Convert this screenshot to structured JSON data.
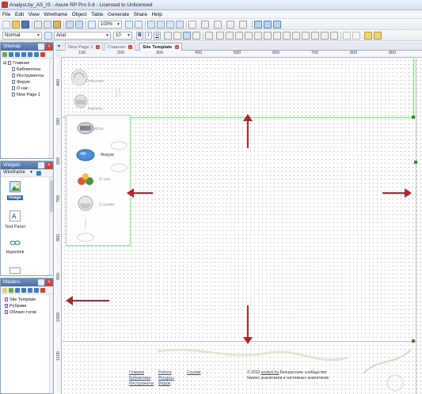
{
  "window": {
    "title": "Analyst.by_AS_IS - Axure RP Pro 5.6 : Licensed to Unlicensed"
  },
  "menu": {
    "items": [
      "File",
      "Edit",
      "View",
      "Wireframe",
      "Object",
      "Table",
      "Generate",
      "Share",
      "Help"
    ]
  },
  "toolbar": {
    "zoom": "100%",
    "style_select": "Normal",
    "font_select": "Arial",
    "size_select": "10",
    "bold_label": "B",
    "italic_label": "I",
    "underline_label": "U"
  },
  "sitemap": {
    "title": "Sitemap",
    "root": "Главная",
    "children": [
      "Библиотека",
      "Инструменты",
      "Форум",
      "О нас",
      "New Page 1"
    ]
  },
  "widgets": {
    "title": "Widgets",
    "library": "Wireframe",
    "items": [
      {
        "label": "Image",
        "icon": "image-icon"
      },
      {
        "label": "Text Panel",
        "icon": "text-panel-icon"
      },
      {
        "label": "Hyperlink",
        "icon": "hyperlink-icon"
      }
    ]
  },
  "masters": {
    "title": "Masters",
    "items": [
      "Site Template",
      "Рубрики",
      "Облако тэгов"
    ]
  },
  "tabs": [
    {
      "label": "New Page 1",
      "active": false
    },
    {
      "label": "Главная",
      "active": false
    },
    {
      "label": "Site Template",
      "active": true
    }
  ],
  "ruler": {
    "h_labels": [
      "100",
      "200",
      "300",
      "400",
      "500",
      "600",
      "700",
      "800",
      "900"
    ],
    "v_labels": [
      "400",
      "500",
      "600",
      "700",
      "800",
      "900",
      "1000",
      "1100"
    ]
  },
  "canvas": {
    "nav_labels_top": [
      "События",
      "Работа"
    ],
    "nav_labels": [
      "Ресурсы",
      "Форум",
      "О нас",
      "Ссылки"
    ],
    "footer": {
      "col1": [
        "Главная",
        "Библиотека",
        "Инструменты"
      ],
      "col2": [
        "Работа",
        "Ресурсы",
        "Форум"
      ],
      "col3": [
        "Ссылки"
      ],
      "copyright_prefix": "© 2010",
      "copyright_link": "analyst.by",
      "copyright_suffix": " Белорусское сообщество",
      "tagline": "бизнес аналитиков и системных аналитиков"
    }
  },
  "colors": {
    "guide": "#8be38b",
    "arrow": "#b0242a",
    "panel_header": "#4b6fa6"
  }
}
